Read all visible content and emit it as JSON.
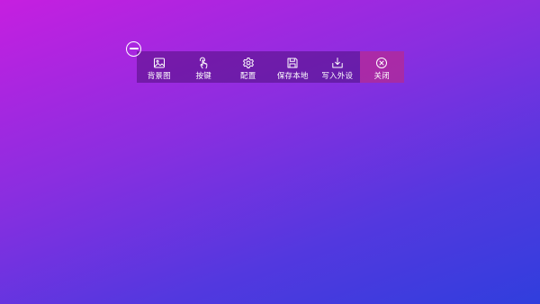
{
  "toolbar": {
    "items": [
      {
        "label": "背景图",
        "icon": "image-icon"
      },
      {
        "label": "按键",
        "icon": "tap-icon"
      },
      {
        "label": "配置",
        "icon": "settings-icon"
      },
      {
        "label": "保存本地",
        "icon": "save-icon"
      },
      {
        "label": "写入外设",
        "icon": "download-icon"
      },
      {
        "label": "关闭",
        "icon": "close-circle-icon"
      }
    ]
  },
  "colors": {
    "background_start": "#c61fe0",
    "background_end": "#303edd",
    "toolbar_bg": "#3a085f",
    "close_bg": "#c42878",
    "text": "#ffffff"
  }
}
